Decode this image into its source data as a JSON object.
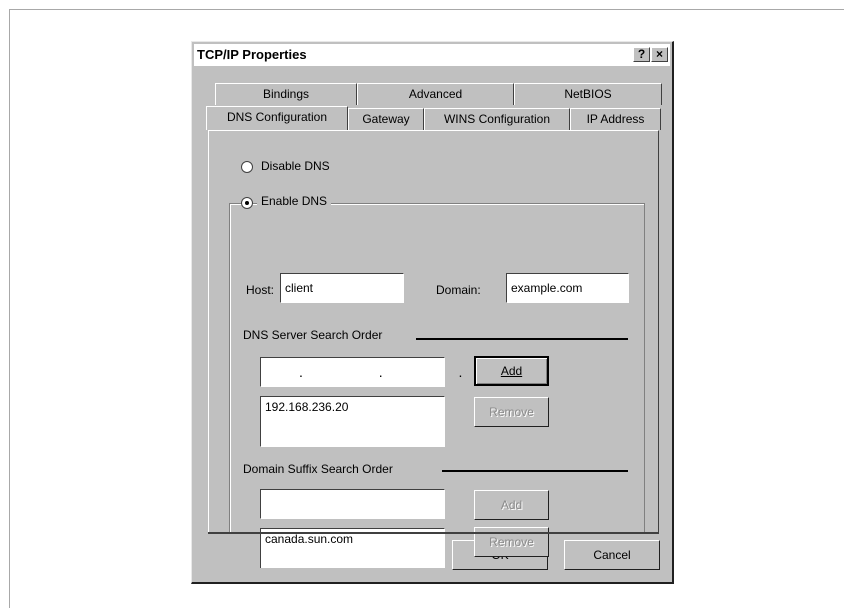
{
  "dialog": {
    "title": "TCP/IP Properties",
    "help_button": "?",
    "close_button": "×"
  },
  "tabs": {
    "back_row": [
      "Bindings",
      "Advanced",
      "NetBIOS"
    ],
    "front_row": [
      "DNS Configuration",
      "Gateway",
      "WINS Configuration",
      "IP Address"
    ],
    "active": "DNS Configuration"
  },
  "dns": {
    "disable_label": "Disable DNS",
    "enable_label": "Enable DNS",
    "selected": "Enable DNS",
    "host_label": "Host:",
    "host_value": "client",
    "domain_label": "Domain:",
    "domain_value": "example.com",
    "server_order_label": "DNS Server Search Order",
    "server_ip_entry": ". . .",
    "server_add": "Add",
    "server_list": [
      "192.168.236.20"
    ],
    "server_remove": "Remove",
    "suffix_order_label": "Domain Suffix Search Order",
    "suffix_entry": "",
    "suffix_add": "Add",
    "suffix_list": [
      "canada.sun.com"
    ],
    "suffix_remove": "Remove"
  },
  "buttons": {
    "ok": "OK",
    "cancel": "Cancel"
  }
}
